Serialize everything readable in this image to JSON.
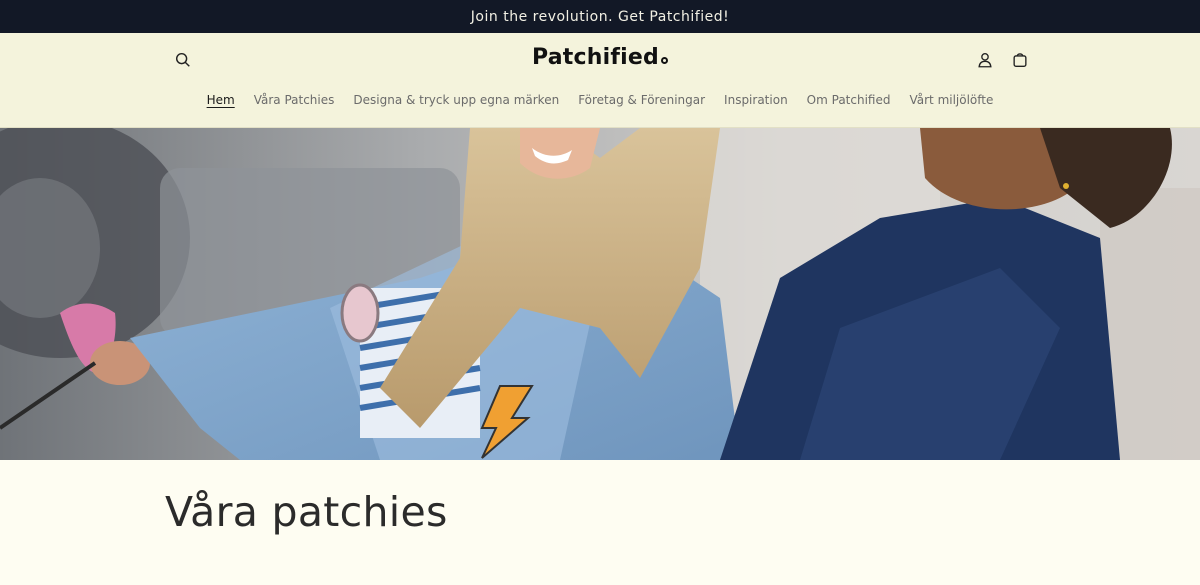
{
  "announcement": {
    "text": "Join the revolution. Get Patchified!"
  },
  "header": {
    "logo_text": "Patchified",
    "icons": {
      "search": "search-icon",
      "account": "account-icon",
      "cart": "cart-icon"
    }
  },
  "nav": {
    "items": [
      {
        "label": "Hem",
        "active": true
      },
      {
        "label": "Våra Patchies"
      },
      {
        "label": "Designa & tryck upp egna märken"
      },
      {
        "label": "Företag & Föreningar"
      },
      {
        "label": "Inspiration"
      },
      {
        "label": "Om Patchified"
      },
      {
        "label": "Vårt miljölöfte"
      }
    ]
  },
  "main": {
    "section_title": "Våra patchies"
  },
  "colors": {
    "announcement_bg": "#121826",
    "header_bg": "#f4f3dc",
    "page_bg": "#fefdf2"
  }
}
